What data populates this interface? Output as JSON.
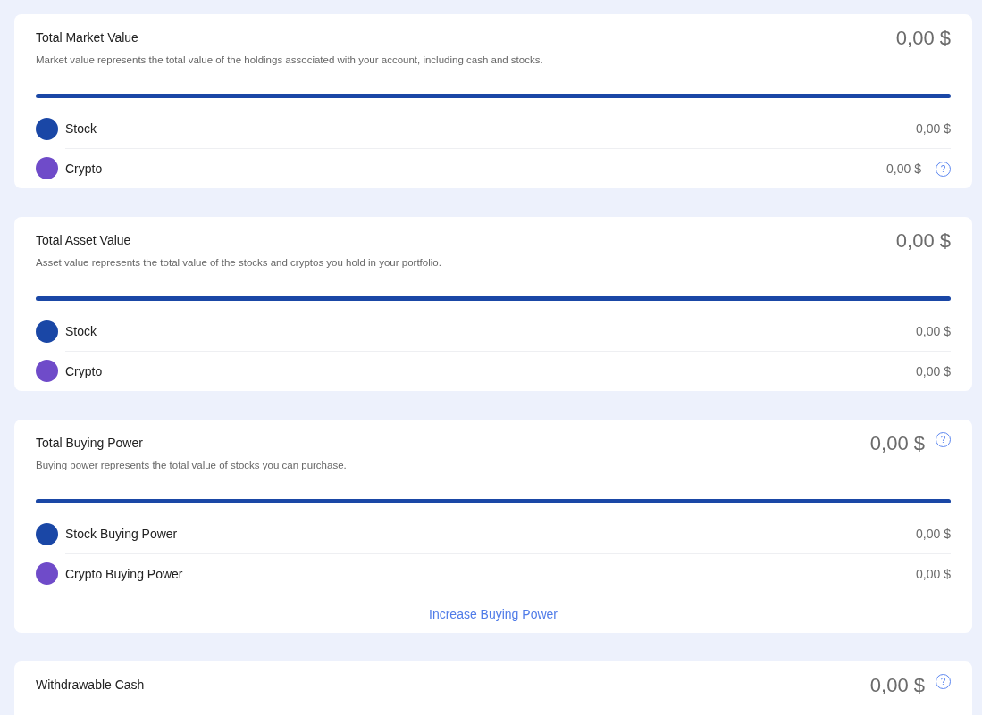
{
  "cards": [
    {
      "title": "Total Market Value",
      "value": "0,00 $",
      "description": "Market value represents the total value of the holdings associated with your account, including cash and stocks.",
      "bar": {
        "level": 1,
        "color": "#1a47a6"
      },
      "rows": [
        {
          "label": "Stock",
          "value": "0,00 $",
          "color": "#1a47a6"
        },
        {
          "label": "Crypto",
          "value": "0,00 $",
          "color": "#6f4bc9",
          "help": "?"
        }
      ]
    },
    {
      "title": "Total Asset Value",
      "value": "0,00 $",
      "description": "Asset value represents the total value of the stocks and cryptos you hold in your portfolio.",
      "bar": {
        "level": 1,
        "color": "#1a47a6"
      },
      "rows": [
        {
          "label": "Stock",
          "value": "0,00 $",
          "color": "#1a47a6"
        },
        {
          "label": "Crypto",
          "value": "0,00 $",
          "color": "#6f4bc9"
        }
      ]
    },
    {
      "title": "Total Buying Power",
      "value": "0,00 $",
      "help": "?",
      "description": "Buying power represents the total value of stocks you can purchase.",
      "bar": {
        "level": 1,
        "color": "#1a47a6"
      },
      "rows": [
        {
          "label": "Stock Buying Power",
          "value": "0,00 $",
          "color": "#1a47a6"
        },
        {
          "label": "Crypto Buying Power",
          "value": "0,00 $",
          "color": "#6f4bc9"
        }
      ],
      "link": "Increase Buying Power"
    },
    {
      "title": "Withdrawable Cash",
      "value": "0,00 $",
      "help": "?"
    }
  ]
}
